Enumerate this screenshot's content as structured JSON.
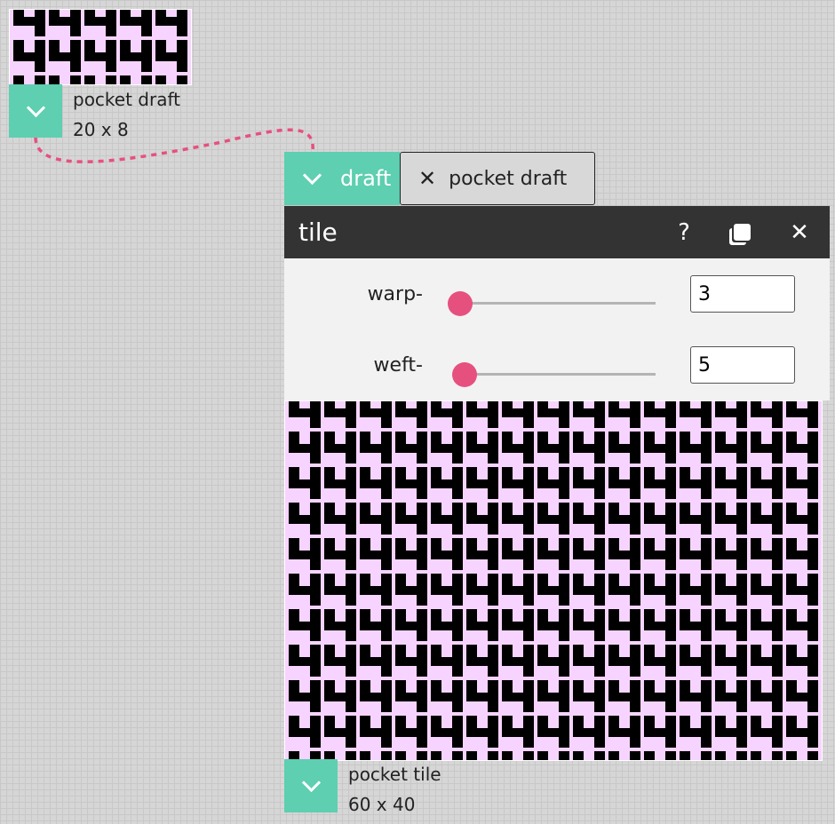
{
  "source_node": {
    "name": "pocket draft",
    "dims": "20 x 8"
  },
  "inlet": {
    "label": "draft",
    "connection_label": "pocket draft"
  },
  "operation": {
    "title": "tile",
    "help_label": "?",
    "params": [
      {
        "label": "warp-",
        "value": "3",
        "slider": 0.0
      },
      {
        "label": "weft-",
        "value": "5",
        "slider": 0.02
      }
    ]
  },
  "output_node": {
    "name": "pocket tile",
    "dims": "60 x 40"
  },
  "colors": {
    "teal": "#5ecfb1",
    "pink": "#e6507f",
    "weft": "#f7d4ff",
    "warp": "#000000",
    "header": "#333333"
  },
  "icons": [
    "chevron-down-icon",
    "close-icon",
    "help-icon",
    "duplicate-icon"
  ]
}
